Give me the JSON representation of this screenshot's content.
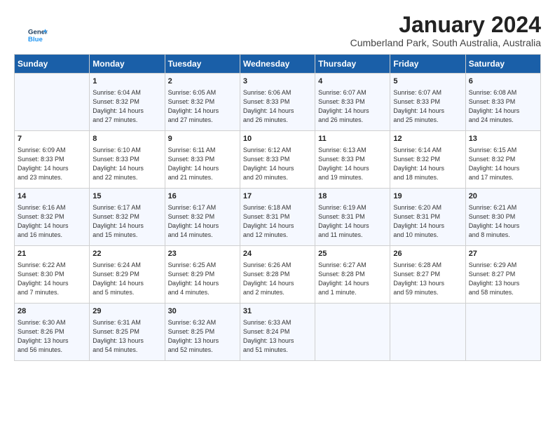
{
  "header": {
    "title": "January 2024",
    "subtitle": "Cumberland Park, South Australia, Australia",
    "logo_line1": "General",
    "logo_line2": "Blue"
  },
  "weekdays": [
    "Sunday",
    "Monday",
    "Tuesday",
    "Wednesday",
    "Thursday",
    "Friday",
    "Saturday"
  ],
  "weeks": [
    [
      {
        "day": "",
        "info": ""
      },
      {
        "day": "1",
        "info": "Sunrise: 6:04 AM\nSunset: 8:32 PM\nDaylight: 14 hours\nand 27 minutes."
      },
      {
        "day": "2",
        "info": "Sunrise: 6:05 AM\nSunset: 8:32 PM\nDaylight: 14 hours\nand 27 minutes."
      },
      {
        "day": "3",
        "info": "Sunrise: 6:06 AM\nSunset: 8:33 PM\nDaylight: 14 hours\nand 26 minutes."
      },
      {
        "day": "4",
        "info": "Sunrise: 6:07 AM\nSunset: 8:33 PM\nDaylight: 14 hours\nand 26 minutes."
      },
      {
        "day": "5",
        "info": "Sunrise: 6:07 AM\nSunset: 8:33 PM\nDaylight: 14 hours\nand 25 minutes."
      },
      {
        "day": "6",
        "info": "Sunrise: 6:08 AM\nSunset: 8:33 PM\nDaylight: 14 hours\nand 24 minutes."
      }
    ],
    [
      {
        "day": "7",
        "info": "Sunrise: 6:09 AM\nSunset: 8:33 PM\nDaylight: 14 hours\nand 23 minutes."
      },
      {
        "day": "8",
        "info": "Sunrise: 6:10 AM\nSunset: 8:33 PM\nDaylight: 14 hours\nand 22 minutes."
      },
      {
        "day": "9",
        "info": "Sunrise: 6:11 AM\nSunset: 8:33 PM\nDaylight: 14 hours\nand 21 minutes."
      },
      {
        "day": "10",
        "info": "Sunrise: 6:12 AM\nSunset: 8:33 PM\nDaylight: 14 hours\nand 20 minutes."
      },
      {
        "day": "11",
        "info": "Sunrise: 6:13 AM\nSunset: 8:33 PM\nDaylight: 14 hours\nand 19 minutes."
      },
      {
        "day": "12",
        "info": "Sunrise: 6:14 AM\nSunset: 8:32 PM\nDaylight: 14 hours\nand 18 minutes."
      },
      {
        "day": "13",
        "info": "Sunrise: 6:15 AM\nSunset: 8:32 PM\nDaylight: 14 hours\nand 17 minutes."
      }
    ],
    [
      {
        "day": "14",
        "info": "Sunrise: 6:16 AM\nSunset: 8:32 PM\nDaylight: 14 hours\nand 16 minutes."
      },
      {
        "day": "15",
        "info": "Sunrise: 6:17 AM\nSunset: 8:32 PM\nDaylight: 14 hours\nand 15 minutes."
      },
      {
        "day": "16",
        "info": "Sunrise: 6:17 AM\nSunset: 8:32 PM\nDaylight: 14 hours\nand 14 minutes."
      },
      {
        "day": "17",
        "info": "Sunrise: 6:18 AM\nSunset: 8:31 PM\nDaylight: 14 hours\nand 12 minutes."
      },
      {
        "day": "18",
        "info": "Sunrise: 6:19 AM\nSunset: 8:31 PM\nDaylight: 14 hours\nand 11 minutes."
      },
      {
        "day": "19",
        "info": "Sunrise: 6:20 AM\nSunset: 8:31 PM\nDaylight: 14 hours\nand 10 minutes."
      },
      {
        "day": "20",
        "info": "Sunrise: 6:21 AM\nSunset: 8:30 PM\nDaylight: 14 hours\nand 8 minutes."
      }
    ],
    [
      {
        "day": "21",
        "info": "Sunrise: 6:22 AM\nSunset: 8:30 PM\nDaylight: 14 hours\nand 7 minutes."
      },
      {
        "day": "22",
        "info": "Sunrise: 6:24 AM\nSunset: 8:29 PM\nDaylight: 14 hours\nand 5 minutes."
      },
      {
        "day": "23",
        "info": "Sunrise: 6:25 AM\nSunset: 8:29 PM\nDaylight: 14 hours\nand 4 minutes."
      },
      {
        "day": "24",
        "info": "Sunrise: 6:26 AM\nSunset: 8:28 PM\nDaylight: 14 hours\nand 2 minutes."
      },
      {
        "day": "25",
        "info": "Sunrise: 6:27 AM\nSunset: 8:28 PM\nDaylight: 14 hours\nand 1 minute."
      },
      {
        "day": "26",
        "info": "Sunrise: 6:28 AM\nSunset: 8:27 PM\nDaylight: 13 hours\nand 59 minutes."
      },
      {
        "day": "27",
        "info": "Sunrise: 6:29 AM\nSunset: 8:27 PM\nDaylight: 13 hours\nand 58 minutes."
      }
    ],
    [
      {
        "day": "28",
        "info": "Sunrise: 6:30 AM\nSunset: 8:26 PM\nDaylight: 13 hours\nand 56 minutes."
      },
      {
        "day": "29",
        "info": "Sunrise: 6:31 AM\nSunset: 8:25 PM\nDaylight: 13 hours\nand 54 minutes."
      },
      {
        "day": "30",
        "info": "Sunrise: 6:32 AM\nSunset: 8:25 PM\nDaylight: 13 hours\nand 52 minutes."
      },
      {
        "day": "31",
        "info": "Sunrise: 6:33 AM\nSunset: 8:24 PM\nDaylight: 13 hours\nand 51 minutes."
      },
      {
        "day": "",
        "info": ""
      },
      {
        "day": "",
        "info": ""
      },
      {
        "day": "",
        "info": ""
      }
    ]
  ]
}
